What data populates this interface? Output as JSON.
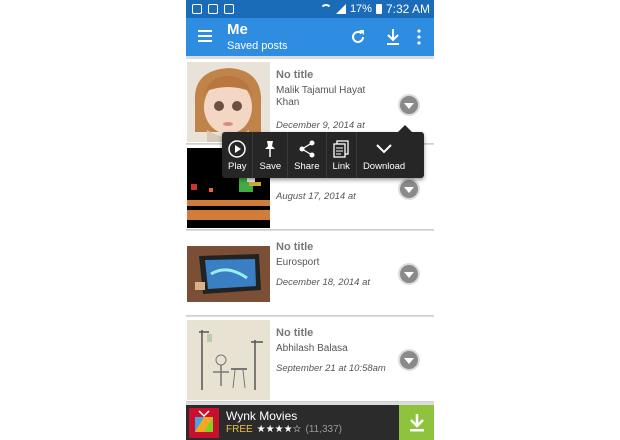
{
  "statusbar": {
    "battery": "17%",
    "time": "7:32 AM"
  },
  "appbar": {
    "title": "Me",
    "subtitle": "Saved posts",
    "icons": [
      "menu-icon",
      "refresh-icon",
      "download-icon",
      "more-icon"
    ]
  },
  "posts": [
    {
      "title": "No title",
      "author": "Malik Tajamul Hayat Khan",
      "date": "December 9, 2014 at"
    },
    {
      "title": "",
      "author": "",
      "date": "August 17, 2014 at"
    },
    {
      "title": "No title",
      "author": "Eurosport",
      "date": "December 18, 2014 at"
    },
    {
      "title": "No title",
      "author": "Abhilash Balasa",
      "date": "September 21 at 10:58am"
    }
  ],
  "popup": {
    "items": [
      {
        "label": "Play",
        "icon": "play-icon"
      },
      {
        "label": "Save",
        "icon": "pin-icon"
      },
      {
        "label": "Share",
        "icon": "share-icon"
      },
      {
        "label": "Link",
        "icon": "copy-link-icon"
      },
      {
        "label": "Download",
        "icon": "chevron-down-icon"
      }
    ]
  },
  "ad": {
    "name": "Wynk Movies",
    "price": "FREE",
    "stars": "★★★★☆",
    "count": "(11,337)"
  },
  "colors": {
    "statusbar": "#1a6bb8",
    "appbar": "#2e8de0",
    "popup": "#262626",
    "ad_download": "#8fc23d"
  }
}
